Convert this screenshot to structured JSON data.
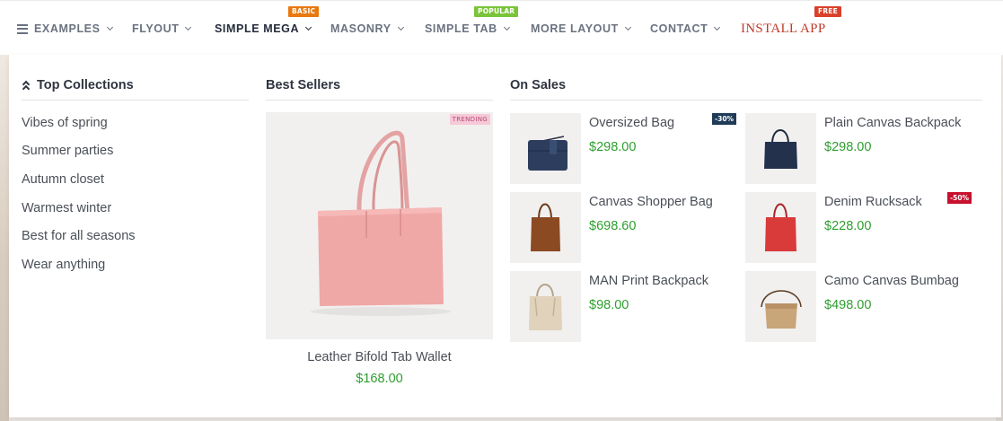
{
  "nav": {
    "items": [
      {
        "label": "EXAMPLES"
      },
      {
        "label": "FLYOUT"
      },
      {
        "label": "SIMPLE MEGA",
        "badge": "BASIC"
      },
      {
        "label": "MASONRY"
      },
      {
        "label": "SIMPLE TAB",
        "badge": "POPULAR"
      },
      {
        "label": "MORE LAYOUT"
      },
      {
        "label": "CONTACT"
      },
      {
        "label": "INSTALL APP",
        "badge": "FREE"
      }
    ],
    "badge_colors": {
      "BASIC": "#e8790f",
      "POPULAR": "#7ac43a",
      "FREE": "#d9412a"
    },
    "install_color": "#c23a2a"
  },
  "mega": {
    "top_collections": {
      "title": "Top Collections",
      "links": [
        "Vibes of spring",
        "Summer parties",
        "Autumn closet",
        "Warmest winter",
        "Best for all seasons",
        "Wear anything"
      ]
    },
    "best_sellers": {
      "title": "Best Sellers",
      "product": {
        "tag": "TRENDING",
        "name": "Leather Bifold Tab Wallet",
        "price": "$168.00",
        "image": "pink-tote-bag"
      }
    },
    "on_sales": {
      "title": "On Sales",
      "products": [
        {
          "name": "Oversized Bag",
          "price": "$298.00",
          "badge": "-30%",
          "image": "navy-crossbody-bag"
        },
        {
          "name": "Plain Canvas Backpack",
          "price": "$298.00",
          "badge": "",
          "image": "navy-tote-bag"
        },
        {
          "name": "Canvas Shopper Bag",
          "price": "$698.60",
          "badge": "",
          "image": "brown-tote-bag"
        },
        {
          "name": "Denim Rucksack",
          "price": "$228.00",
          "badge": "-50%",
          "image": "red-tote-bag"
        },
        {
          "name": "MAN Print Backpack",
          "price": "$98.00",
          "badge": "",
          "image": "beige-tote-bag"
        },
        {
          "name": "Camo Canvas Bumbag",
          "price": "$498.00",
          "badge": "",
          "image": "tan-bucket-bag"
        }
      ]
    }
  },
  "colors": {
    "price": "#2e9e2e",
    "badge_dark": "#1f3b57",
    "badge_red": "#c8102e",
    "link": "#4a4f57"
  }
}
